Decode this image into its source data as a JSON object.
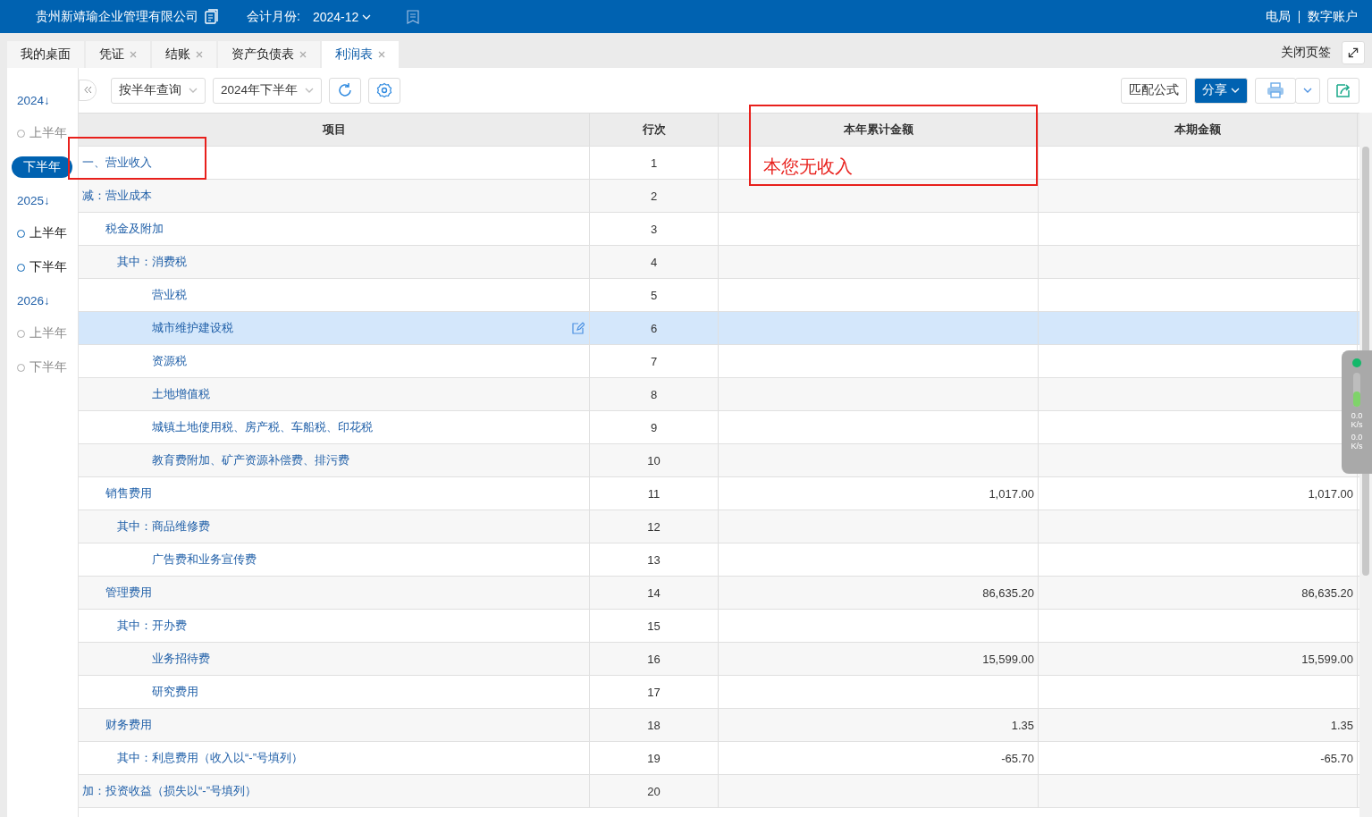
{
  "header": {
    "company": "贵州新靖瑜企业管理有限公司",
    "period_label": "会计月份:",
    "period": "2024-12",
    "links": [
      "电局",
      "数字账户"
    ]
  },
  "tabs": [
    {
      "label": "我的桌面",
      "closable": false,
      "selected": false
    },
    {
      "label": "凭证",
      "closable": true,
      "selected": false
    },
    {
      "label": "结账",
      "closable": true,
      "selected": false
    },
    {
      "label": "资产负债表",
      "closable": true,
      "selected": false
    },
    {
      "label": "利润表",
      "closable": true,
      "selected": true
    }
  ],
  "close_tabs": "关闭页签",
  "timeline": [
    {
      "year": "2024↓",
      "halves": [
        {
          "label": "上半年",
          "enabled": false,
          "selected": false
        },
        {
          "label": "下半年",
          "enabled": true,
          "selected": true
        }
      ]
    },
    {
      "year": "2025↓",
      "halves": [
        {
          "label": "上半年",
          "enabled": true,
          "selected": false
        },
        {
          "label": "下半年",
          "enabled": true,
          "selected": false
        }
      ]
    },
    {
      "year": "2026↓",
      "halves": [
        {
          "label": "上半年",
          "enabled": false,
          "selected": false
        },
        {
          "label": "下半年",
          "enabled": false,
          "selected": false
        }
      ]
    }
  ],
  "toolbar": {
    "mode": "按半年查询",
    "period": "2024年下半年",
    "match_formula": "匹配公式",
    "share": "分享"
  },
  "table": {
    "columns": [
      "项目",
      "行次",
      "本年累计金额",
      "本期金额"
    ],
    "rows": [
      {
        "kind": "top",
        "item": "一、营业收入",
        "line": "1",
        "ytd": "",
        "current": "",
        "selected": false
      },
      {
        "kind": "top",
        "item": "减：营业成本",
        "line": "2",
        "ytd": "",
        "current": "",
        "selected": false
      },
      {
        "kind": "main",
        "item": "税金及附加",
        "line": "3",
        "ytd": "",
        "current": "",
        "selected": false
      },
      {
        "kind": "of",
        "item": "其中：消费税",
        "line": "4",
        "ytd": "",
        "current": "",
        "selected": false
      },
      {
        "kind": "detail",
        "item": "营业税",
        "line": "5",
        "ytd": "",
        "current": "",
        "selected": false
      },
      {
        "kind": "detail",
        "item": "城市维护建设税",
        "line": "6",
        "ytd": "",
        "current": "",
        "selected": true
      },
      {
        "kind": "detail",
        "item": "资源税",
        "line": "7",
        "ytd": "",
        "current": "",
        "selected": false
      },
      {
        "kind": "detail",
        "item": "土地增值税",
        "line": "8",
        "ytd": "",
        "current": "",
        "selected": false
      },
      {
        "kind": "detail",
        "item": "城镇土地使用税、房产税、车船税、印花税",
        "line": "9",
        "ytd": "",
        "current": "",
        "selected": false
      },
      {
        "kind": "detail",
        "item": "教育费附加、矿产资源补偿费、排污费",
        "line": "10",
        "ytd": "",
        "current": "",
        "selected": false
      },
      {
        "kind": "main",
        "item": "销售费用",
        "line": "11",
        "ytd": "1,017.00",
        "current": "1,017.00",
        "selected": false
      },
      {
        "kind": "of",
        "item": "其中：商品维修费",
        "line": "12",
        "ytd": "",
        "current": "",
        "selected": false
      },
      {
        "kind": "detail",
        "item": "广告费和业务宣传费",
        "line": "13",
        "ytd": "",
        "current": "",
        "selected": false
      },
      {
        "kind": "main",
        "item": "管理费用",
        "line": "14",
        "ytd": "86,635.20",
        "current": "86,635.20",
        "selected": false
      },
      {
        "kind": "of",
        "item": "其中：开办费",
        "line": "15",
        "ytd": "",
        "current": "",
        "selected": false
      },
      {
        "kind": "detail",
        "item": "业务招待费",
        "line": "16",
        "ytd": "15,599.00",
        "current": "15,599.00",
        "selected": false
      },
      {
        "kind": "detail",
        "item": "研究费用",
        "line": "17",
        "ytd": "",
        "current": "",
        "selected": false
      },
      {
        "kind": "main",
        "item": "财务费用",
        "line": "18",
        "ytd": "1.35",
        "current": "1.35",
        "selected": false
      },
      {
        "kind": "of",
        "item": "其中：利息费用（收入以“-”号填列）",
        "line": "19",
        "ytd": "-65.70",
        "current": "-65.70",
        "selected": false
      },
      {
        "kind": "top",
        "item": "加：投资收益（损失以“-”号填列）",
        "line": "20",
        "ytd": "",
        "current": "",
        "selected": false
      }
    ]
  },
  "annotation": {
    "note": "本您无收入"
  },
  "speed_widget": {
    "upload": "0.0",
    "upload_unit": "K/s",
    "download": "0.0",
    "download_unit": "K/s"
  }
}
